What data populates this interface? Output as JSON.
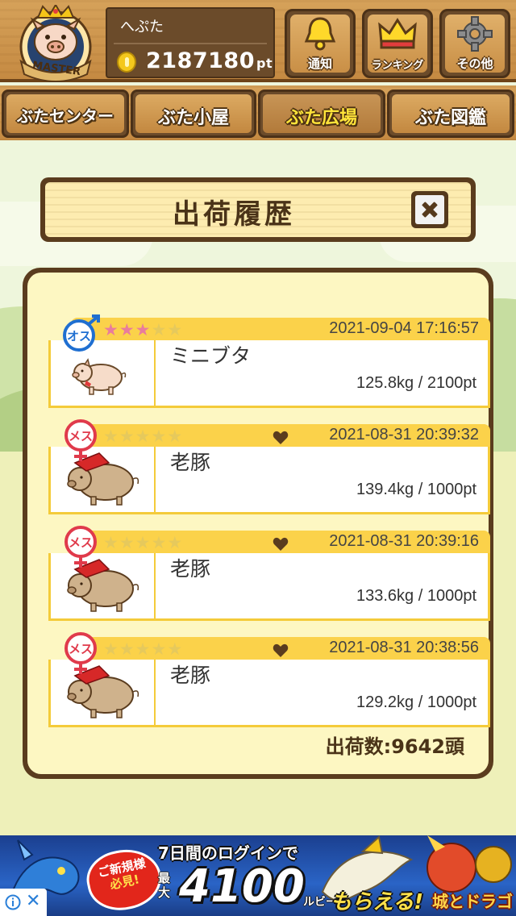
{
  "header": {
    "badge_text": "MASTER",
    "user_name": "へぷた",
    "points": "2187180",
    "points_unit": "pt",
    "buttons": [
      {
        "label": "通知",
        "icon": "bell-icon"
      },
      {
        "label": "ランキング",
        "icon": "crown-icon"
      },
      {
        "label": "その他",
        "icon": "gear-icon"
      }
    ]
  },
  "nav": {
    "tabs": [
      {
        "label": "ぶたセンター",
        "active": false
      },
      {
        "label": "ぶた小屋",
        "active": false
      },
      {
        "label": "ぶた広場",
        "active": true
      },
      {
        "label": "ぶた図鑑",
        "active": false
      }
    ]
  },
  "dialog": {
    "title": "出荷履歴",
    "ship_count": "出荷数:9642頭"
  },
  "entries": [
    {
      "gender": "オス",
      "gender_icon": "male-icon",
      "stars_filled": 3,
      "stars_total": 5,
      "favorite": false,
      "date": "2021-09-04 17:16:57",
      "name": "ミニブタ",
      "weight": "125.8kg / 2100pt",
      "pig_type": "mini-pig"
    },
    {
      "gender": "メス",
      "gender_icon": "female-icon",
      "stars_filled": 0,
      "stars_total": 5,
      "favorite": true,
      "date": "2021-08-31 20:39:32",
      "name": "老豚",
      "weight": "139.4kg / 1000pt",
      "pig_type": "old-pig"
    },
    {
      "gender": "メス",
      "gender_icon": "female-icon",
      "stars_filled": 0,
      "stars_total": 5,
      "favorite": true,
      "date": "2021-08-31 20:39:16",
      "name": "老豚",
      "weight": "133.6kg / 1000pt",
      "pig_type": "old-pig"
    },
    {
      "gender": "メス",
      "gender_icon": "female-icon",
      "stars_filled": 0,
      "stars_total": 5,
      "favorite": true,
      "date": "2021-08-31 20:38:56",
      "name": "老豚",
      "weight": "129.2kg / 1000pt",
      "pig_type": "old-pig"
    }
  ],
  "ad": {
    "burst_line1": "ご新規様",
    "burst_line2": "必見!",
    "headline": "7日間のログインで",
    "max_label": "最大",
    "amount": "4100",
    "amount_unit": "ルビー",
    "get_text": "もらえる!",
    "logo": "城とドラゴン",
    "close": "✕"
  },
  "colors": {
    "wood": "#c58a42",
    "panel_border": "#5a3c1e",
    "panel_bg": "#fdf7c2",
    "strip_yellow": "#fbd24a",
    "star_pink": "#e97c9c",
    "star_empty": "#e6c95c",
    "male_blue": "#1f6fd1",
    "female_red": "#e03a4b",
    "active_tab_text": "#ffe43a"
  }
}
